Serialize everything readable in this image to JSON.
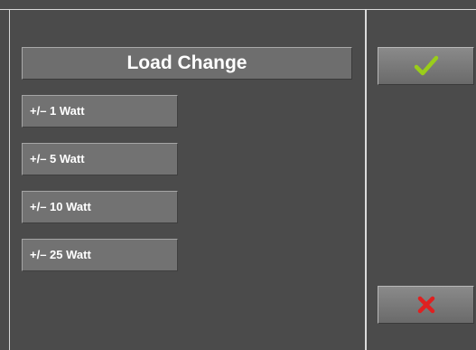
{
  "dialog": {
    "title": "Load Change",
    "options": [
      {
        "label": "+/– 1 Watt"
      },
      {
        "label": "+/– 5 Watt"
      },
      {
        "label": "+/– 10 Watt"
      },
      {
        "label": "+/– 25 Watt"
      }
    ]
  },
  "actions": {
    "confirm_icon": "checkmark-icon",
    "cancel_icon": "cross-icon"
  },
  "colors": {
    "background": "#4b4b4b",
    "button": "#727272",
    "confirm": "#9acd1a",
    "cancel": "#e02020"
  }
}
